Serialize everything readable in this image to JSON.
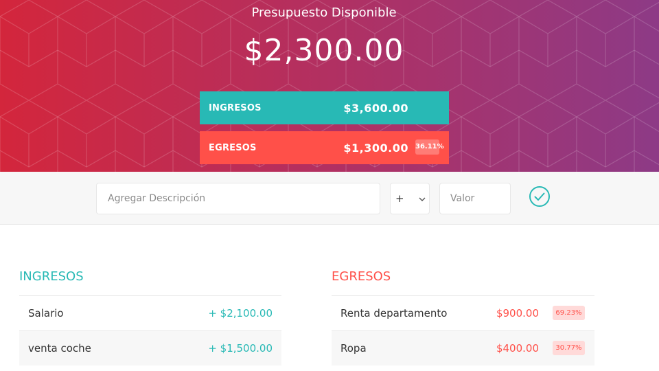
{
  "budget": {
    "title": "Presupuesto Disponible",
    "value": "$2,300.00"
  },
  "summary": {
    "income": {
      "label": "INGRESOS",
      "value": "$3,600.00"
    },
    "expense": {
      "label": "EGRESOS",
      "value": "$1,300.00",
      "percentage": "36.11%"
    }
  },
  "add_form": {
    "description_placeholder": "Agregar Descripción",
    "type_selected": "+",
    "value_placeholder": "Valor",
    "submit_icon": "check-circle-icon"
  },
  "income_list": {
    "title": "INGRESOS",
    "items": [
      {
        "description": "Salario",
        "value": "+ $2,100.00"
      },
      {
        "description": "venta coche",
        "value": "+ $1,500.00"
      }
    ]
  },
  "expense_list": {
    "title": "EGRESOS",
    "items": [
      {
        "description": "Renta departamento",
        "value": "$900.00",
        "percentage": "69.23%"
      },
      {
        "description": "Ropa",
        "value": "$400.00",
        "percentage": "30.77%"
      }
    ]
  },
  "colors": {
    "income": "#28b9b5",
    "expense": "#ff5049",
    "header_gradient_start": "#d3263c",
    "header_gradient_end": "#8d3a86"
  }
}
